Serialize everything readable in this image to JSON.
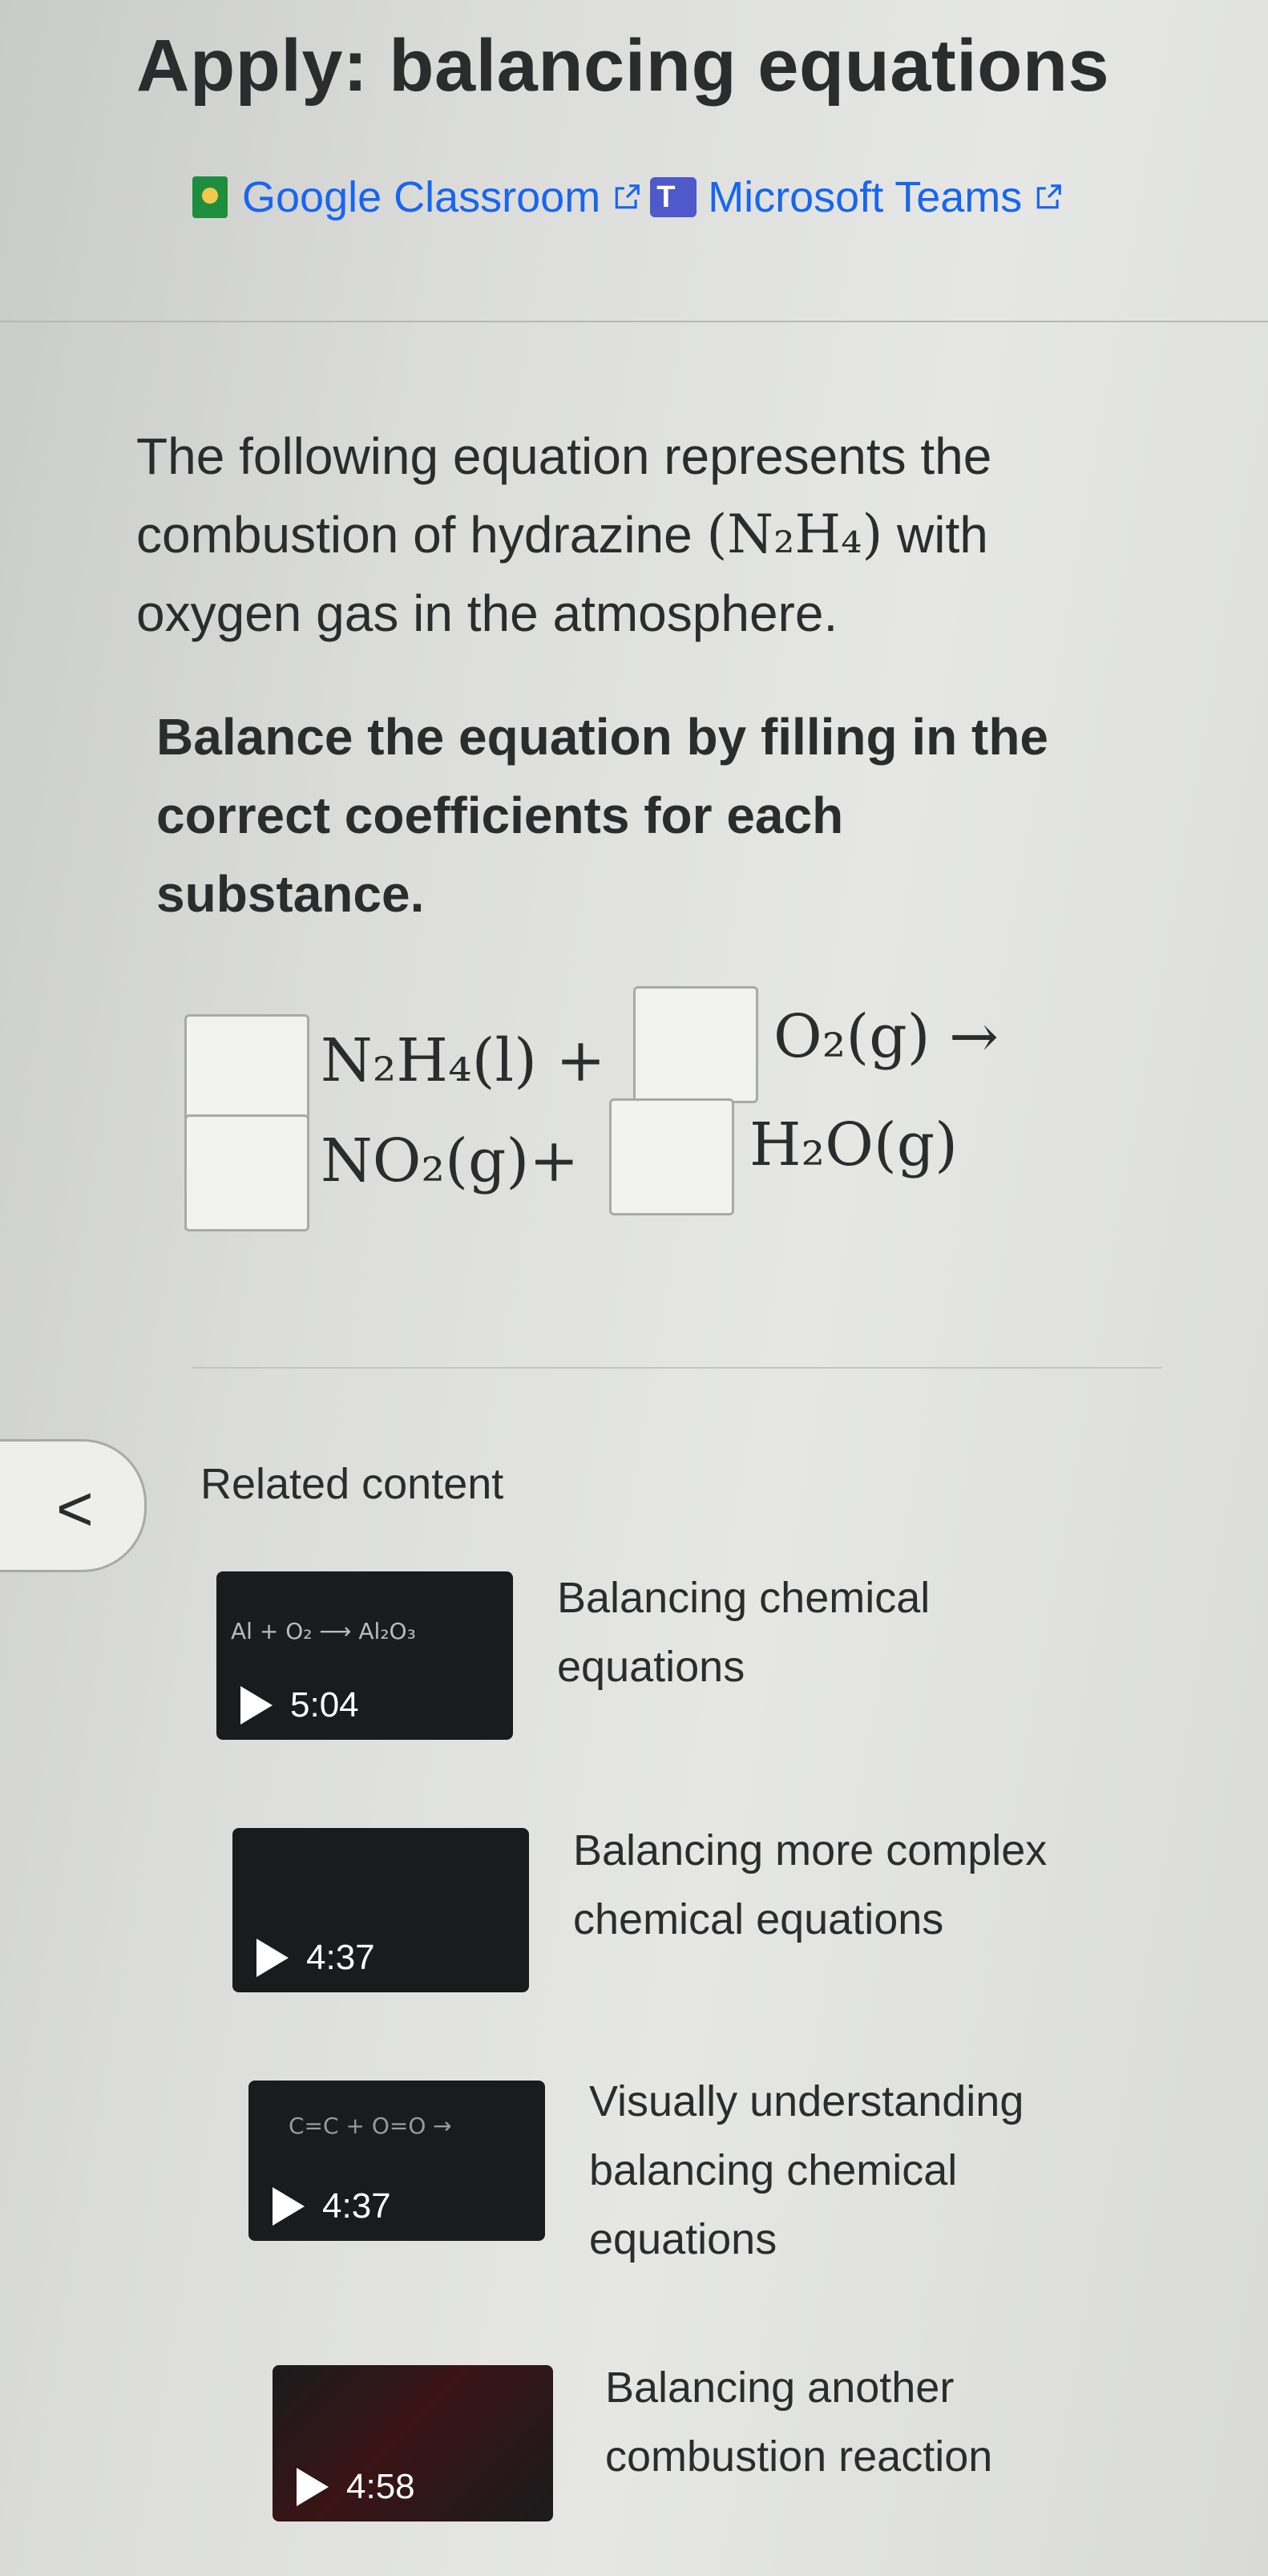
{
  "page": {
    "title": "Apply: balancing equations",
    "share": {
      "google_classroom": "Google Classroom",
      "microsoft_teams": "Microsoft Teams"
    }
  },
  "question": {
    "intro_line1": "The following equation represents the",
    "intro_line2_prefix": "combustion of hydrazine ",
    "intro_line2_formula": "(N₂H₄)",
    "intro_line2_suffix": " with",
    "intro_line3": "oxygen gas in the atmosphere.",
    "instruction_line1": "Balance the equation by filling in the",
    "instruction_line2": "correct coefficients for each",
    "instruction_line3": "substance.",
    "equation": {
      "reactant1": "N₂H₄(l) +",
      "reactant2": "O₂(g) →",
      "product1": "NO₂(g)+",
      "product2": "H₂O(g)"
    }
  },
  "related": {
    "heading": "Related content",
    "items": [
      {
        "title_line1": "Balancing chemical",
        "title_line2": "equations",
        "title_line3": "",
        "duration": "5:04",
        "thumb_text": "Al  +  O₂  ⟶  Al₂O₃"
      },
      {
        "title_line1": "Balancing more complex",
        "title_line2": "chemical equations",
        "title_line3": "",
        "duration": "4:37",
        "thumb_text": ""
      },
      {
        "title_line1": "Visually understanding",
        "title_line2": "balancing chemical",
        "title_line3": "equations",
        "duration": "4:37",
        "thumb_text": "C=C  +  O=O →"
      },
      {
        "title_line1": "Balancing another",
        "title_line2": "combustion reaction",
        "title_line3": "",
        "duration": "4:58",
        "thumb_text": ""
      }
    ]
  },
  "icons": [
    "google-classroom-icon",
    "external-link-icon",
    "microsoft-teams-icon",
    "chevron-left-icon",
    "play-icon"
  ],
  "colors": {
    "link": "#1865f2",
    "text": "#2b2c2e",
    "thumb_bg": "#1a1b1d"
  }
}
